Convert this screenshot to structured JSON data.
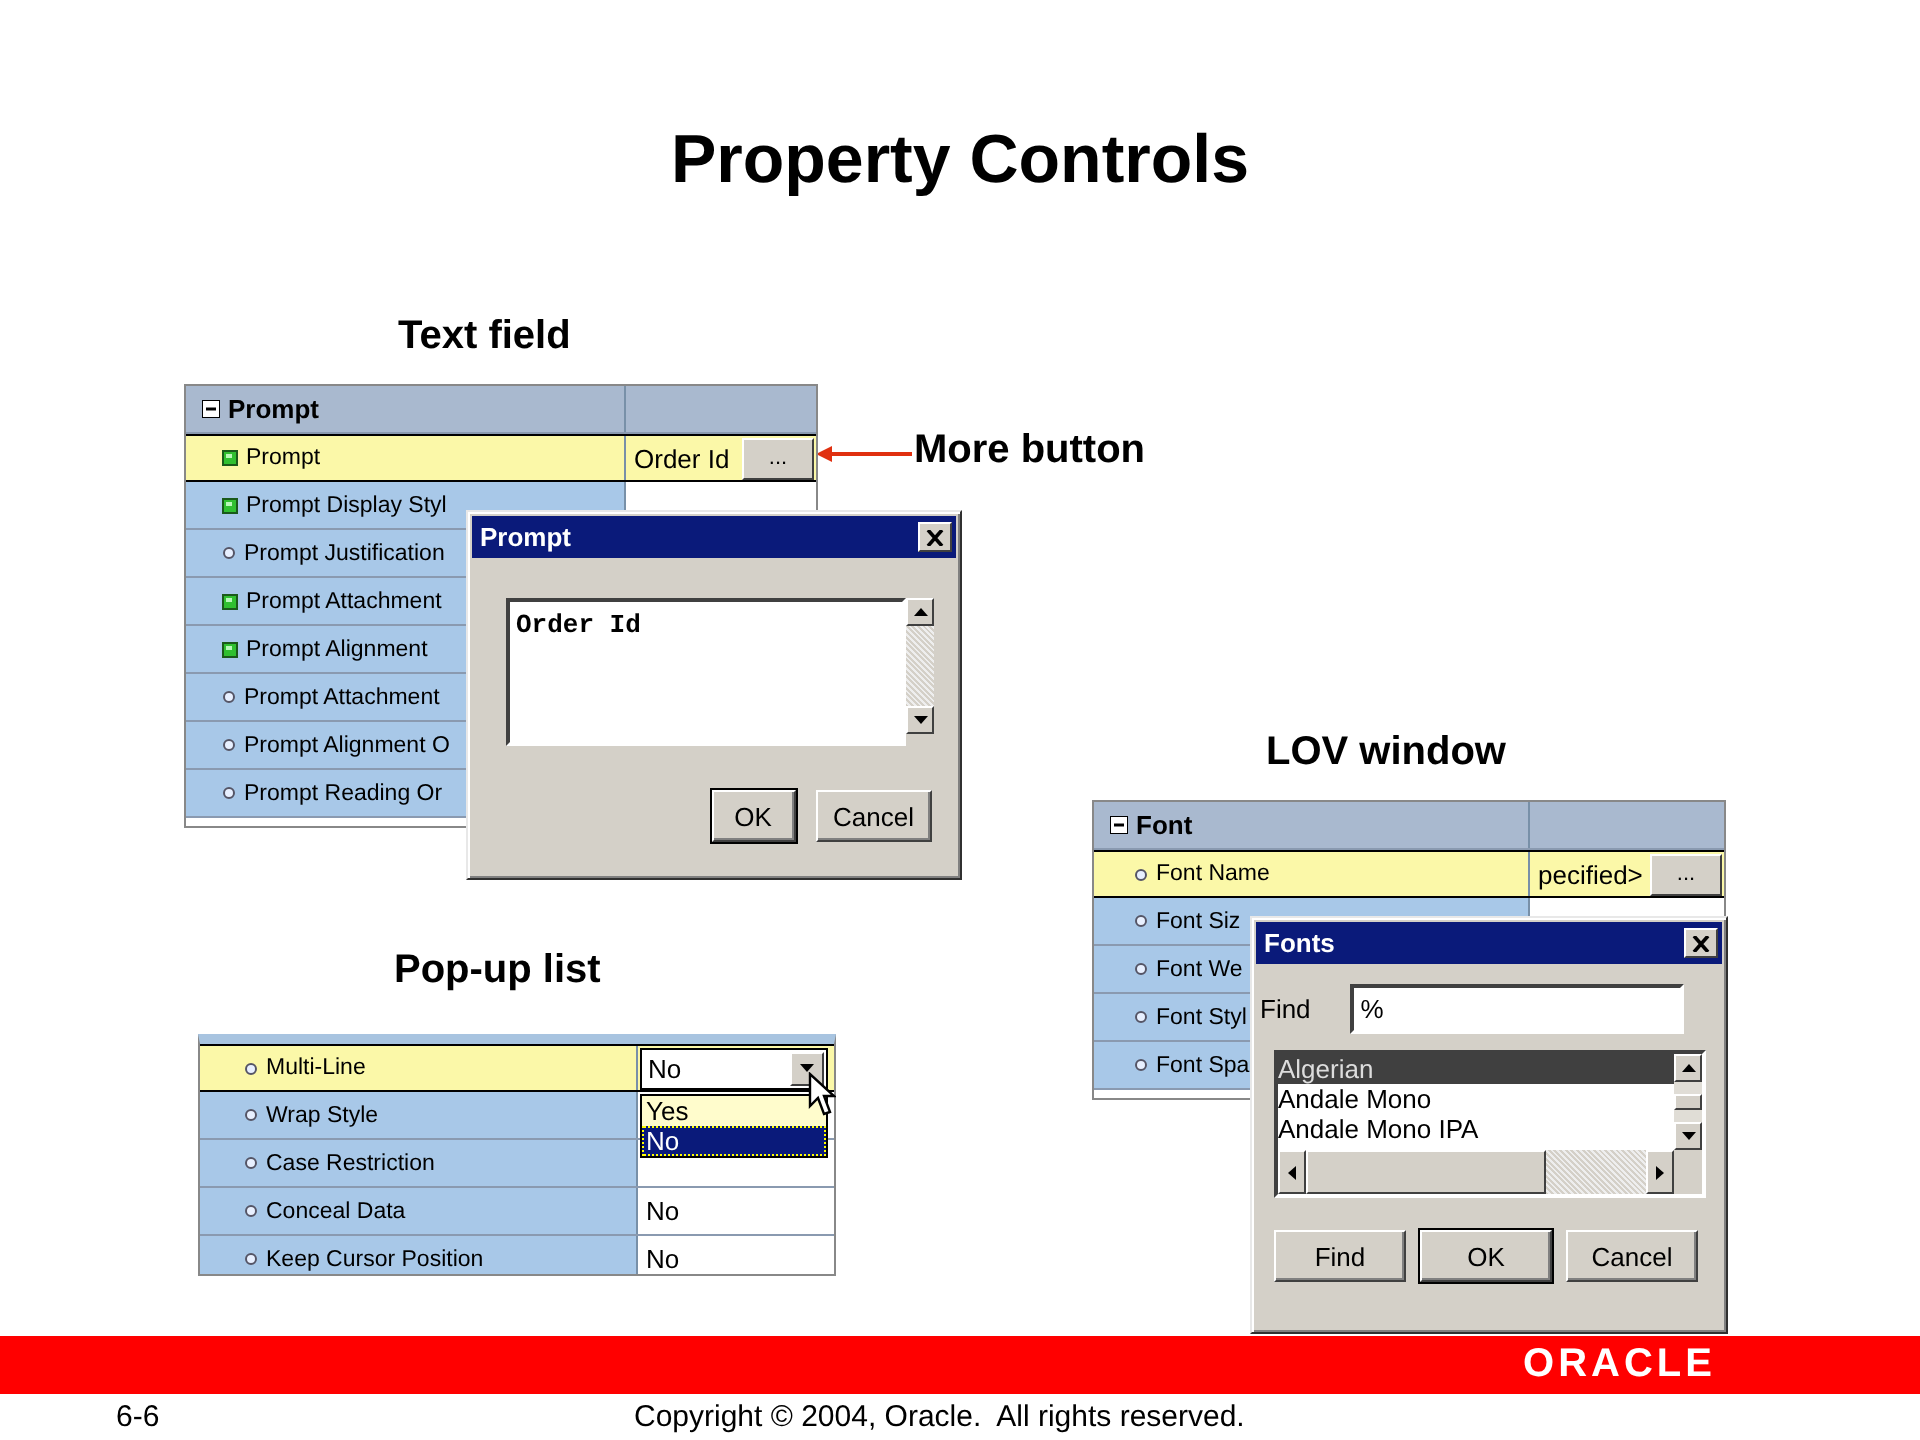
{
  "slide": {
    "title": "Property Controls"
  },
  "callouts": [
    {
      "kind": "text-field",
      "text": "Text field"
    },
    {
      "kind": "more-button",
      "text": "More button"
    },
    {
      "kind": "lov",
      "text": "LOV window"
    },
    {
      "kind": "popup",
      "text": "Pop-up list"
    }
  ],
  "prompt_sheet": {
    "category": "Prompt",
    "expanded": true,
    "rows": [
      {
        "name": "Prompt",
        "kind": "square",
        "selected": true,
        "value": "Order Id",
        "more_button": "..."
      },
      {
        "name": "Prompt Display Styl",
        "kind": "square",
        "selected": false
      },
      {
        "name": "Prompt Justification",
        "kind": "dot",
        "selected": false
      },
      {
        "name": "Prompt Attachment",
        "kind": "square",
        "selected": false
      },
      {
        "name": "Prompt Alignment",
        "kind": "square",
        "selected": false
      },
      {
        "name": "Prompt Attachment",
        "kind": "dot",
        "selected": false
      },
      {
        "name": "Prompt Alignment O",
        "kind": "dot",
        "selected": false
      },
      {
        "name": "Prompt Reading Or",
        "kind": "dot",
        "selected": false
      }
    ]
  },
  "prompt_dialog": {
    "title": "Prompt",
    "text": "Order Id",
    "buttons": [
      {
        "label": "OK",
        "default": true
      },
      {
        "label": "Cancel",
        "default": false
      }
    ]
  },
  "popup_sheet": {
    "rows": [
      {
        "name": "Multi-Line",
        "kind": "dot",
        "selected": true,
        "dropdown": {
          "value": "No"
        }
      },
      {
        "name": "Wrap Style",
        "kind": "dot",
        "selected": false
      },
      {
        "name": "Case Restriction",
        "kind": "dot",
        "selected": false
      },
      {
        "name": "Conceal Data",
        "kind": "dot",
        "selected": false,
        "value": "No"
      },
      {
        "name": "Keep Cursor Position",
        "kind": "dot",
        "selected": false,
        "value": "No"
      }
    ],
    "dropdown_list": [
      {
        "label": "Yes",
        "selected": false
      },
      {
        "label": "No",
        "selected": true
      }
    ]
  },
  "font_sheet": {
    "category": "Font",
    "expanded": true,
    "rows": [
      {
        "name": "Font Name",
        "kind": "dot",
        "selected": true,
        "value": "pecified>",
        "more_button": "..."
      },
      {
        "name": "Font Siz",
        "kind": "dot",
        "selected": false
      },
      {
        "name": "Font We",
        "kind": "dot",
        "selected": false
      },
      {
        "name": "Font Styl",
        "kind": "dot",
        "selected": false
      },
      {
        "name": "Font Spa",
        "kind": "dot",
        "selected": false
      }
    ]
  },
  "fonts_dialog": {
    "title": "Fonts",
    "find_label": "Find",
    "find_value": "%",
    "items": [
      {
        "label": "Algerian",
        "selected": true
      },
      {
        "label": "Andale Mono",
        "selected": false
      },
      {
        "label": "Andale Mono IPA",
        "selected": false
      }
    ],
    "buttons": [
      {
        "label": "Find",
        "default": false
      },
      {
        "label": "OK",
        "default": true
      },
      {
        "label": "Cancel",
        "default": false
      }
    ]
  },
  "footer": {
    "page": "6-6",
    "copyright": "Copyright © 2004, Oracle.  All rights reserved.",
    "logo": "ORACLE"
  }
}
